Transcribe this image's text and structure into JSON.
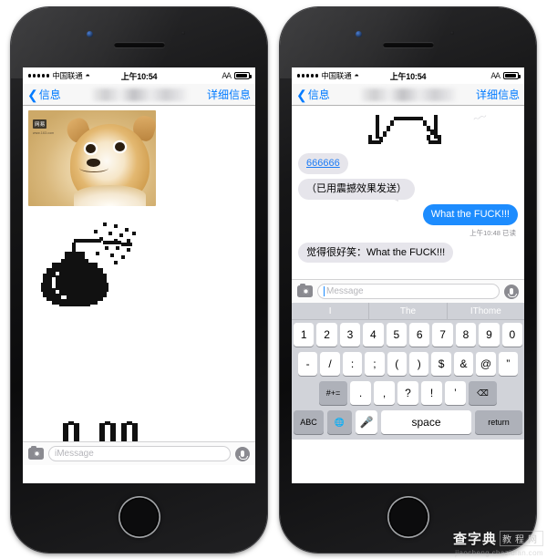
{
  "status_bar": {
    "signal_dots": 5,
    "carrier": "中国联通",
    "wifi_icon": "wifi-icon",
    "time": "上午10:54",
    "bluetooth_icon": "bluetooth-icon",
    "battery_icon": "battery-icon"
  },
  "nav_bar": {
    "back_label": "信息",
    "back_icon": "chevron-left-icon",
    "title_redacted": true,
    "detail_label": "详细信息"
  },
  "left_phone": {
    "attachments": [
      {
        "type": "photo",
        "name": "doge-photo",
        "watermark_box": "网易",
        "watermark_sub": "www.163.com"
      },
      {
        "type": "pixel-art",
        "name": "bomb-emoji"
      },
      {
        "type": "pixel-art",
        "name": "cutoff-graphic"
      }
    ],
    "input_bar": {
      "camera_icon": "camera-icon",
      "placeholder": "iMessage",
      "value": "",
      "mic_icon": "microphone-icon",
      "has_caret": false
    }
  },
  "right_phone": {
    "top_graphic": "pixel-outline-graphic",
    "messages": [
      {
        "side": "in",
        "text": "666666",
        "is_link": true
      },
      {
        "side": "in",
        "text": "（已用震撼效果发送）",
        "is_link": false
      },
      {
        "side": "out",
        "text": "What the FUCK!!!",
        "is_link": false
      },
      {
        "side": "in",
        "text": "觉得很好笑：What the FUCK!!!",
        "is_link": false
      }
    ],
    "timestamp": "上午10:48 已读",
    "input_bar": {
      "camera_icon": "camera-icon",
      "placeholder": "Message",
      "value": "",
      "mic_icon": "microphone-icon",
      "has_caret": true
    },
    "keyboard": {
      "predictions": [
        "I",
        "The",
        "IThome"
      ],
      "row_numbers": [
        "1",
        "2",
        "3",
        "4",
        "5",
        "6",
        "7",
        "8",
        "9",
        "0"
      ],
      "row_symbols": [
        "-",
        "/",
        ":",
        ";",
        "(",
        ")",
        "$",
        "&",
        "@",
        "”"
      ],
      "row_punct": {
        "shift_label": "#+=",
        "keys": [
          ".",
          ",",
          "?",
          "!",
          "’"
        ],
        "delete_icon": "delete-key-icon"
      },
      "row_bottom": {
        "abc_label": "ABC",
        "globe_icon": "globe-icon",
        "mic_icon": "microphone-key-icon",
        "space_label": "space",
        "return_label": "return"
      }
    }
  },
  "colors": {
    "imessage_blue": "#1d8cfe",
    "incoming_gray": "#e6e5eb",
    "link_blue": "#1b7bf5",
    "tint": "#007aff",
    "keyboard_bg": "#d1d3d9"
  },
  "watermark": {
    "brand_cn": "查字典",
    "brand_box": "教程网",
    "url": "jiaocheng.chazidian.com"
  }
}
